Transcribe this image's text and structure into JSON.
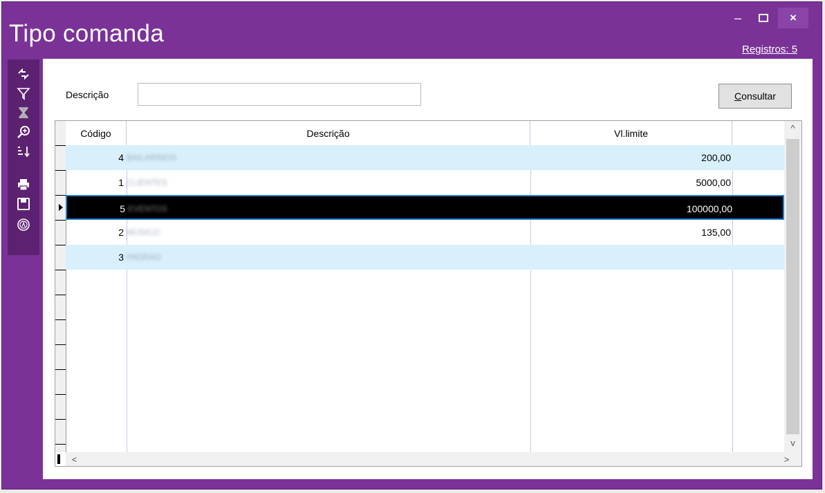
{
  "window": {
    "title": "Tipo comanda",
    "minimize": "–",
    "maximize": "□",
    "close": "×",
    "registros": "Registros: 5"
  },
  "toolbar": {
    "icons": [
      "refresh-icon",
      "filter-icon",
      "clear-filter-icon",
      "zoom-icon",
      "sort-icon",
      "print-icon",
      "save-icon",
      "ai-icon"
    ]
  },
  "search": {
    "label": "Descrição",
    "value": "",
    "button": "Consultar"
  },
  "grid": {
    "columns": [
      "Código",
      "Descrição",
      "Vl.limite"
    ],
    "rows": [
      {
        "codigo": "4",
        "descricao": "BAILARINOS",
        "limite": "200,00"
      },
      {
        "codigo": "1",
        "descricao": "CLIENTES",
        "limite": "5000,00"
      },
      {
        "codigo": "5",
        "descricao": "EVENTOS",
        "limite": "100000,00"
      },
      {
        "codigo": "2",
        "descricao": "MÚSICO",
        "limite": "135,00"
      },
      {
        "codigo": "3",
        "descricao": "PADRAO",
        "limite": ""
      }
    ],
    "selected_row": 2,
    "scroll_up": "^",
    "scroll_down": "v",
    "scroll_left": "<",
    "scroll_right": ">"
  },
  "colors": {
    "frame": "#7a3297",
    "toolbar": "#5c2271",
    "row_alt": "#d8f0fb",
    "row_selected": "#000000"
  }
}
